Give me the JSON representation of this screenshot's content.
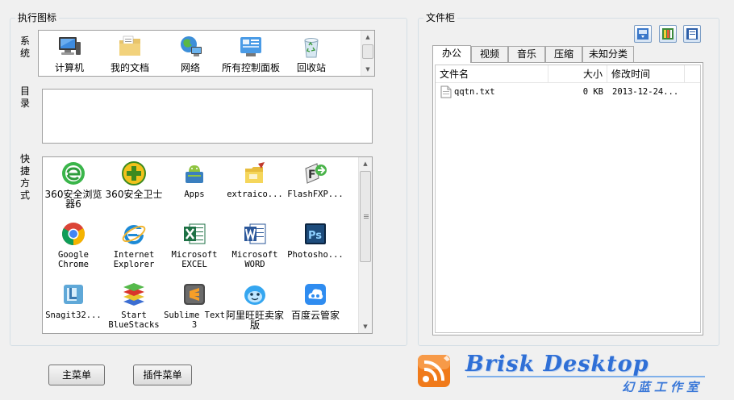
{
  "launch_group": {
    "title": "执行图标",
    "system_label": "系统",
    "catalog_label": "目录",
    "shortcuts_label": "快捷方式",
    "system_icons": [
      {
        "label": "计算机",
        "icon": "computer-icon"
      },
      {
        "label": "我的文档",
        "icon": "documents-folder-icon"
      },
      {
        "label": "网络",
        "icon": "network-globe-icon"
      },
      {
        "label": "所有控制面板项",
        "icon": "control-panel-icon"
      },
      {
        "label": "回收站",
        "icon": "recycle-bin-icon"
      }
    ],
    "shortcuts": [
      {
        "label": "360安全浏览器6",
        "icon": "360-browser-icon"
      },
      {
        "label": "360安全卫士",
        "icon": "360-safe-icon"
      },
      {
        "label": "Apps",
        "icon": "android-apps-icon"
      },
      {
        "label": "extraico...",
        "icon": "extraicon-folder-icon"
      },
      {
        "label": "FlashFXP...",
        "icon": "flashfxp-icon"
      },
      {
        "label": "Google Chrome",
        "icon": "chrome-icon"
      },
      {
        "label": "Internet Explorer",
        "icon": "internet-explorer-icon"
      },
      {
        "label": "Microsoft EXCEL",
        "icon": "excel-icon"
      },
      {
        "label": "Microsoft WORD",
        "icon": "word-icon"
      },
      {
        "label": "Photosho...",
        "icon": "photoshop-icon"
      },
      {
        "label": "Snagit32...",
        "icon": "snagit-icon"
      },
      {
        "label": "Start BlueStacks",
        "icon": "bluestacks-icon"
      },
      {
        "label": "Sublime Text 3",
        "icon": "sublime-text-icon"
      },
      {
        "label": "阿里旺旺卖家版",
        "icon": "aliwangwang-icon"
      },
      {
        "label": "百度云管家",
        "icon": "baidu-cloud-icon"
      }
    ]
  },
  "file_cabinet": {
    "title": "文件柜",
    "toolbar_icons": [
      "cabinet-settings-icon",
      "cabinet-archive-icon",
      "cabinet-view-icon"
    ],
    "tabs": [
      "办公",
      "视频",
      "音乐",
      "压缩",
      "未知分类"
    ],
    "columns": [
      "文件名",
      "大小",
      "修改时间"
    ],
    "files": [
      {
        "name": "qqtn.txt",
        "size": "0 KB",
        "modified": "2013-12-24..."
      }
    ]
  },
  "buttons": {
    "main_menu": "主菜单",
    "plugin_menu": "插件菜单"
  },
  "branding": {
    "title": "Brisk Desktop",
    "subtitle": "幻蓝工作室",
    "logo_icon": "rss-feed-logo-icon",
    "colors": {
      "brand_blue": "#2f6fd6",
      "rss_orange": "#f07a1a"
    }
  }
}
